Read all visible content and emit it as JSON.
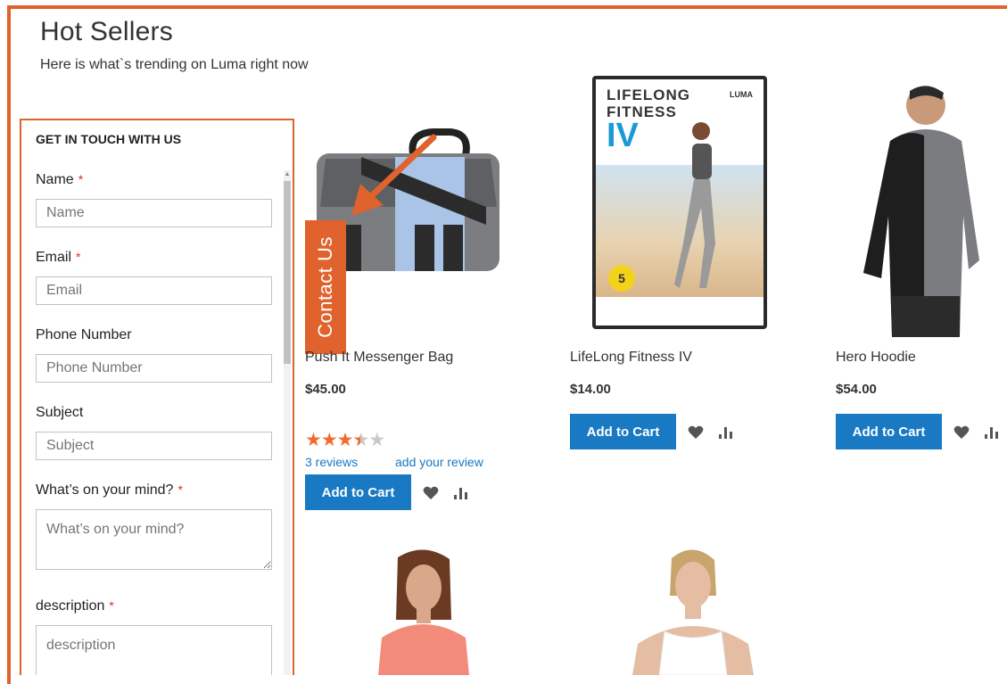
{
  "section": {
    "title": "Hot Sellers",
    "subtitle": "Here is what`s trending on Luma right now"
  },
  "products": [
    {
      "name": "Push It Messenger Bag",
      "price": "$45.00",
      "rating_stars": 3.5,
      "rating_max": 5,
      "reviews_label": "3  reviews",
      "add_review_label": "add your review",
      "cart_label": "Add to Cart"
    },
    {
      "name": "LifeLong Fitness IV",
      "price": "$14.00",
      "cart_label": "Add to Cart"
    },
    {
      "name": "Hero Hoodie",
      "price": "$54.00",
      "cart_label": "Add to Cart"
    }
  ],
  "dvd": {
    "title_line1": "LIFELONG",
    "title_line2": "FITNESS",
    "title_line3": "IV",
    "brand": "LUMA",
    "badge": "5"
  },
  "contact_tab": {
    "label": "Contact Us"
  },
  "contact_form": {
    "heading": "GET IN TOUCH WITH US",
    "required_mark": "*",
    "fields": [
      {
        "label": "Name",
        "placeholder": "Name",
        "required": true
      },
      {
        "label": "Email",
        "placeholder": "Email",
        "required": true
      },
      {
        "label": "Phone Number",
        "placeholder": "Phone Number",
        "required": false
      },
      {
        "label": "Subject",
        "placeholder": "Subject",
        "required": false
      },
      {
        "label": "What’s on your mind?",
        "placeholder": "What’s on your mind?",
        "required": true
      },
      {
        "label": "description",
        "placeholder": "description",
        "required": true
      }
    ]
  },
  "colors": {
    "accent": "#e0622d",
    "button": "#1979c3",
    "star": "#f26b2a"
  },
  "icons": {
    "wishlist": "heart-icon",
    "compare": "compare-bars-icon"
  }
}
